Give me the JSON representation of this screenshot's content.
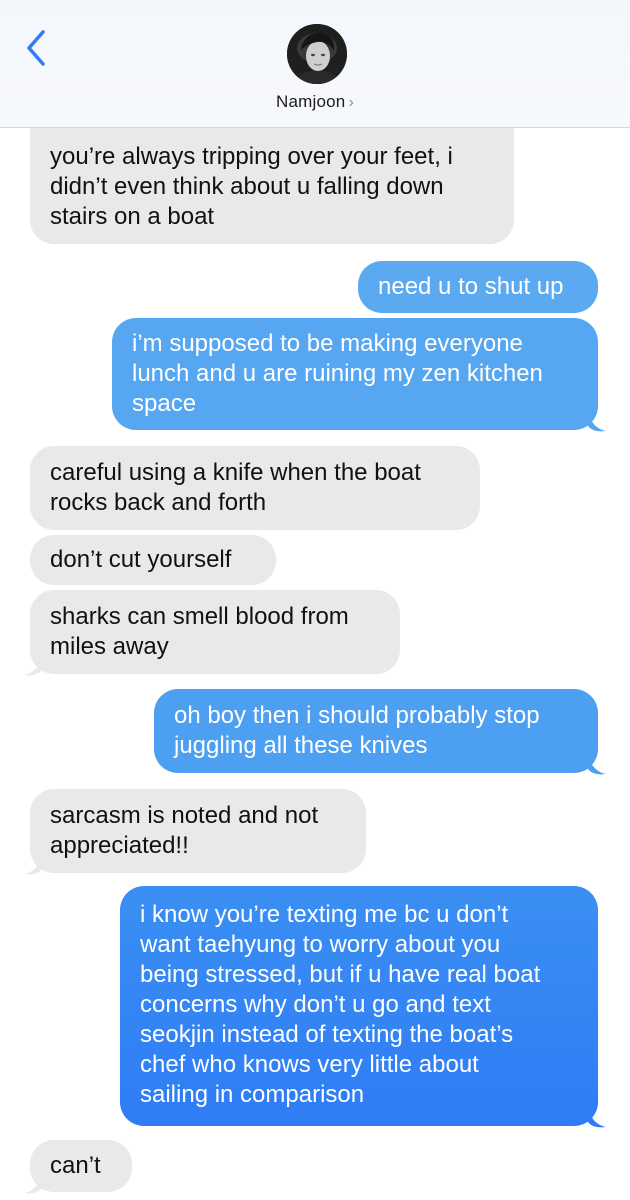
{
  "header": {
    "contact_name": "Namjoon",
    "chevron": "›",
    "back_icon": "chevron-left-icon"
  },
  "colors": {
    "incoming_bubble": "#e9e9eb",
    "outgoing_bubble_top": "#5aabf3",
    "outgoing_bubble_bottom": "#2b7bf0",
    "accent": "#2f7cf6"
  },
  "messages": [
    {
      "direction": "incoming",
      "lines": [
        "you’re always tripping over your feet, i",
        "didn’t even think about u falling down",
        "stairs on a boat"
      ]
    },
    {
      "direction": "outgoing",
      "lines": [
        "need u to shut up"
      ]
    },
    {
      "direction": "outgoing",
      "lines": [
        "i’m supposed to be making everyone",
        "lunch and u are ruining my zen kitchen",
        "space"
      ]
    },
    {
      "direction": "incoming",
      "lines": [
        "careful using a knife when the boat",
        "rocks back and forth"
      ]
    },
    {
      "direction": "incoming",
      "lines": [
        "don’t cut yourself"
      ]
    },
    {
      "direction": "incoming",
      "lines": [
        "sharks can smell blood from",
        "miles away"
      ]
    },
    {
      "direction": "outgoing",
      "lines": [
        "oh boy then i should probably stop",
        "juggling all these knives"
      ]
    },
    {
      "direction": "incoming",
      "lines": [
        "sarcasm is noted and not",
        "appreciated!!"
      ]
    },
    {
      "direction": "outgoing",
      "lines": [
        "i know you’re texting me bc u don’t",
        "want taehyung to worry about you",
        "being stressed, but if u have real boat",
        "concerns why don’t u go and text",
        "seokjin instead of texting the boat’s",
        "chef who knows very little about",
        "sailing in comparison"
      ]
    },
    {
      "direction": "incoming",
      "lines": [
        "can’t"
      ]
    }
  ]
}
